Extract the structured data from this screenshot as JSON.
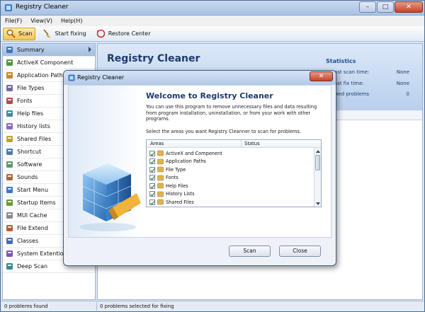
{
  "window": {
    "title": "Registry Cleaner"
  },
  "menu": [
    "File(F)",
    "View(V)",
    "Help(H)"
  ],
  "toolbar": {
    "scan": "Scan",
    "start_fixing": "Start fixing",
    "restore_center": "Restore Center"
  },
  "sidebar": {
    "items": [
      {
        "label": "Summary",
        "icon": "summary-icon"
      },
      {
        "label": "ActiveX Component",
        "icon": "activex-icon"
      },
      {
        "label": "Application Paths",
        "icon": "app-paths-icon"
      },
      {
        "label": "File Types",
        "icon": "file-types-icon"
      },
      {
        "label": "Fonts",
        "icon": "fonts-icon"
      },
      {
        "label": "Help files",
        "icon": "help-files-icon"
      },
      {
        "label": "History lists",
        "icon": "history-icon"
      },
      {
        "label": "Shared Files",
        "icon": "shared-files-icon"
      },
      {
        "label": "Shortcut",
        "icon": "shortcut-icon"
      },
      {
        "label": "Software",
        "icon": "software-icon"
      },
      {
        "label": "Sounds",
        "icon": "sounds-icon"
      },
      {
        "label": "Start Menu",
        "icon": "start-menu-icon"
      },
      {
        "label": "Startup Items",
        "icon": "startup-icon"
      },
      {
        "label": "MUI Cache",
        "icon": "mui-cache-icon"
      },
      {
        "label": "File Extend",
        "icon": "file-extend-icon"
      },
      {
        "label": "Classes",
        "icon": "classes-icon"
      },
      {
        "label": "System Extentions",
        "icon": "system-ext-icon"
      },
      {
        "label": "Deep Scan",
        "icon": "deep-scan-icon"
      }
    ]
  },
  "main": {
    "title": "Registry Cleaner",
    "statistics": {
      "title": "Statistics",
      "rows": [
        {
          "label": "Last scan time:",
          "value": "None"
        },
        {
          "label": "Last fix time:",
          "value": "None"
        },
        {
          "label": "Fixed problems",
          "value": "0"
        }
      ]
    }
  },
  "status": {
    "left": "0 problems found",
    "right": "0 problems selected for fixing"
  },
  "dialog": {
    "title": "Registry Cleaner",
    "heading": "Welcome to Registry Cleaner",
    "description": "You can use this program to remove unnecessary files and data resulting from program installation, uninstallation,  or from your work with other programs.",
    "prompt": "Select the areas you want Registry Cleanner to scan for problems.",
    "columns": {
      "areas": "Areas",
      "status": "Status"
    },
    "areas": [
      {
        "label": "ActiveX and Component",
        "checked": true
      },
      {
        "label": "Application Paths",
        "checked": true
      },
      {
        "label": "File Type",
        "checked": true
      },
      {
        "label": "Fonts",
        "checked": true
      },
      {
        "label": "Help Files",
        "checked": true
      },
      {
        "label": "History Lists",
        "checked": true
      },
      {
        "label": "Shared Files",
        "checked": true
      }
    ],
    "buttons": {
      "scan": "Scan",
      "close": "Close"
    }
  },
  "colors": {
    "accent": "#1d3a6e",
    "title_blue": "#1d4f91",
    "toolbar_active": "#f6c35a",
    "close_red": "#c5432a"
  }
}
